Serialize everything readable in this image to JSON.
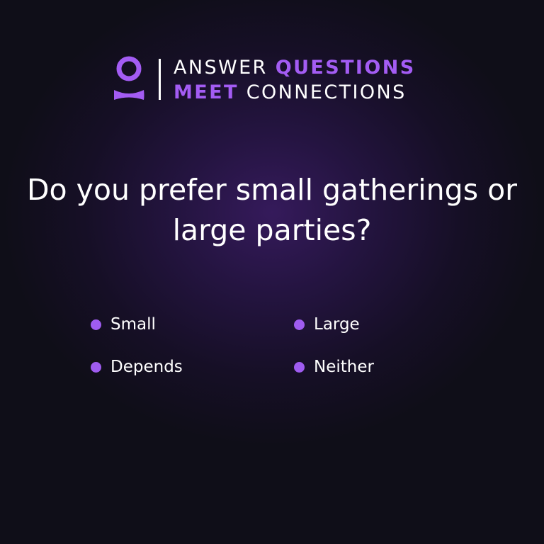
{
  "colors": {
    "accent": "#a35cf3",
    "text": "#ffffff",
    "background": "#0f0e18"
  },
  "header": {
    "logo_icon": "person-icon",
    "line1": {
      "light": "ANSWER",
      "accent": "QUESTIONS"
    },
    "line2": {
      "accent": "MEET",
      "light": "CONNECTIONS"
    }
  },
  "question": {
    "line1": "Do you prefer small gatherings or",
    "line2": "large parties?"
  },
  "options": [
    {
      "label": "Small"
    },
    {
      "label": "Large"
    },
    {
      "label": "Depends"
    },
    {
      "label": "Neither"
    }
  ]
}
